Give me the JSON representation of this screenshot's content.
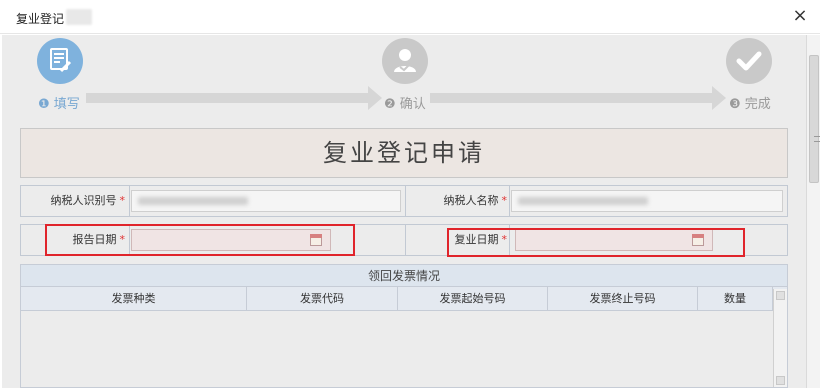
{
  "window": {
    "title": "复业登记",
    "close_symbol": "×"
  },
  "steps": [
    {
      "label": "❶ 填写",
      "icon": "form-edit-icon"
    },
    {
      "label": "❷ 确认",
      "icon": "user-check-icon"
    },
    {
      "label": "❸ 完成",
      "icon": "check-icon"
    }
  ],
  "form": {
    "heading": "复业登记申请",
    "taxpayer_id_label": "纳税人识别号",
    "taxpayer_name_label": "纳税人名称",
    "report_date_label": "报告日期",
    "resume_date_label": "复业日期",
    "required_mark": "*"
  },
  "table": {
    "title": "领回发票情况",
    "columns": [
      "发票种类",
      "发票代码",
      "发票起始号码",
      "发票终止号码",
      "数量"
    ]
  },
  "colors": {
    "active_step": "#7fb2dd",
    "inactive_step": "#c9c9c9",
    "highlight_box": "#e0242b",
    "required_star": "#e03030"
  }
}
